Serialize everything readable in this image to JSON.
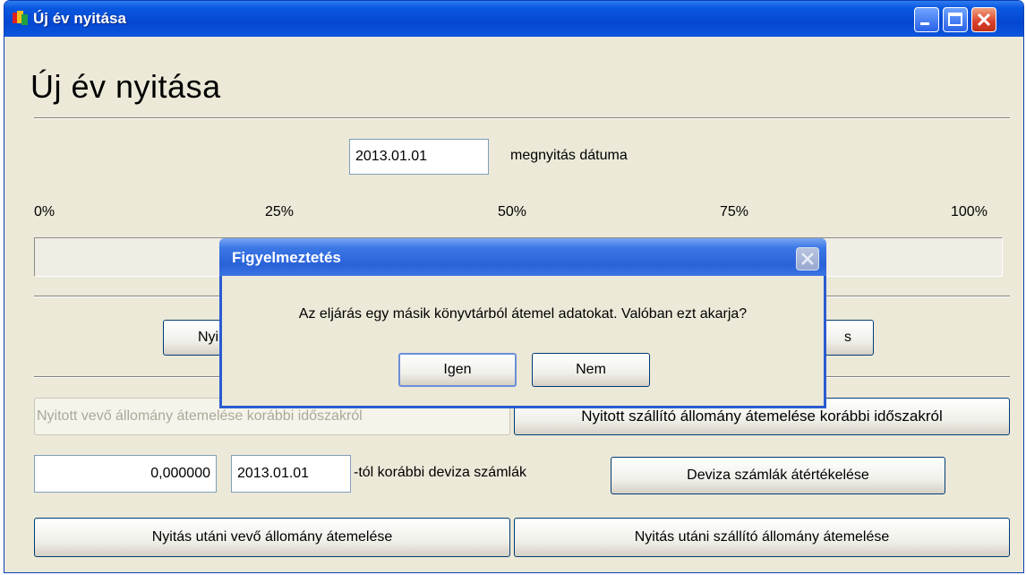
{
  "window": {
    "title": "Új év nyitása"
  },
  "page": {
    "heading": "Új év nyitása"
  },
  "opening_date": {
    "value": "2013.01.01",
    "label": "megnyitás dátuma"
  },
  "progress": {
    "scale": [
      "0%",
      "25%",
      "50%",
      "75%",
      "100%"
    ],
    "value": 0
  },
  "row1": {
    "left_button_partial": "Nyi",
    "right_button_partial": "s"
  },
  "transfers": {
    "customer_prior": "Nyitott vevő állomány átemelése korábbi időszakról",
    "supplier_prior": "Nyitott szállító állomány átemelése korábbi időszakról"
  },
  "currency": {
    "amount": "0,000000",
    "date": "2013.01.01",
    "label": "-tól korábbi deviza számlák",
    "revalue_button": "Deviza számlák átértékelése"
  },
  "after_opening": {
    "customer_button": "Nyitás utáni vevő állomány átemelése",
    "supplier_button": "Nyitás utáni szállító állomány átemelése"
  },
  "dialog": {
    "title": "Figyelmeztetés",
    "message": "Az eljárás egy másik könyvtárból átemel adatokat. Valóban ezt akarja?",
    "yes": "Igen",
    "no": "Nem"
  },
  "colors": {
    "title_bar": "#0447d0",
    "window_bg": "#ece9d8",
    "close_button": "#d8402a"
  }
}
